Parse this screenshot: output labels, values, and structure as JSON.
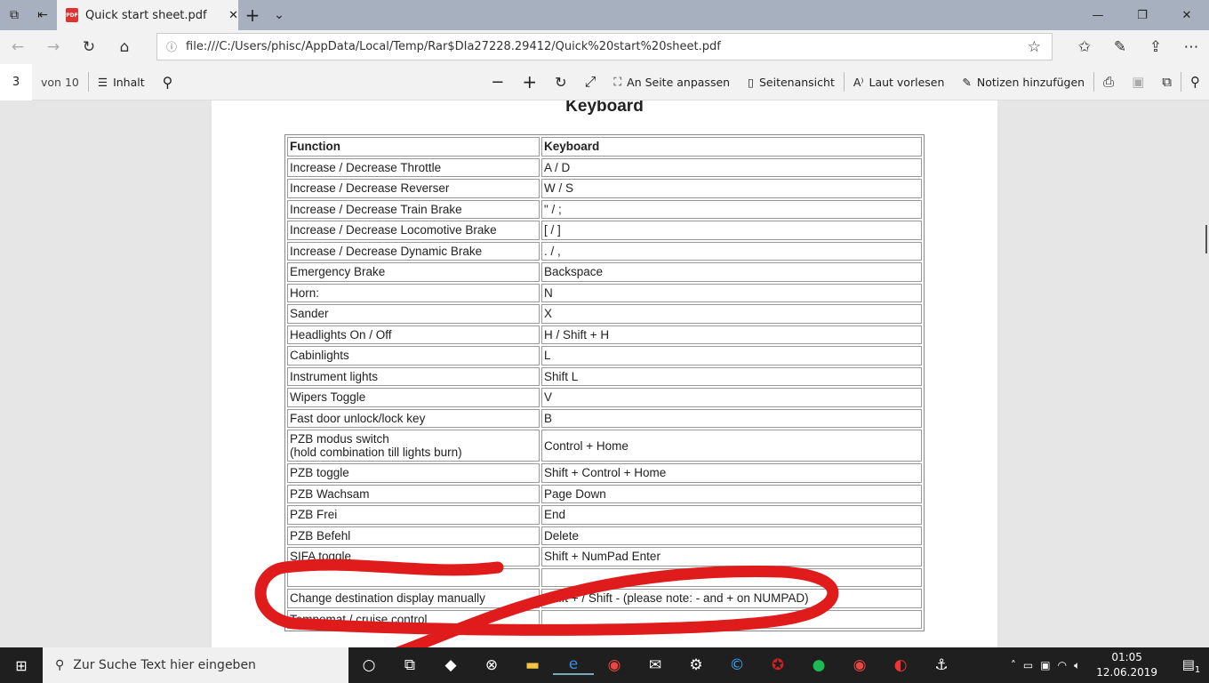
{
  "browser": {
    "tab_title": "Quick start sheet.pdf",
    "url": "file:///C:/Users/phisc/AppData/Local/Temp/Rar$DIa27228.29412/Quick%20start%20sheet.pdf"
  },
  "pdf_toolbar": {
    "page": "3",
    "of_pages": "von 10",
    "contents": "Inhalt",
    "fit_page": "An Seite anpassen",
    "page_view": "Seitenansicht",
    "read_aloud": "Laut vorlesen",
    "add_notes": "Notizen hinzufügen"
  },
  "document": {
    "title": "Keyboard",
    "headers": [
      "Function",
      "Keyboard"
    ],
    "rows": [
      [
        "Increase / Decrease Throttle",
        "A / D"
      ],
      [
        "Increase / Decrease Reverser",
        "W / S"
      ],
      [
        "Increase / Decrease Train Brake",
        "\" / ;"
      ],
      [
        "Increase / Decrease Locomotive Brake",
        "[ / ]"
      ],
      [
        "Increase / Decrease Dynamic Brake",
        ". / ,"
      ],
      [
        "Emergency Brake",
        "Backspace"
      ],
      [
        "Horn:",
        "N"
      ],
      [
        "Sander",
        "X"
      ],
      [
        "Headlights On / Off",
        "H / Shift + H"
      ],
      [
        "Cabinlights",
        "L"
      ],
      [
        "Instrument lights",
        "Shift L"
      ],
      [
        "Wipers Toggle",
        "V"
      ],
      [
        "Fast door unlock/lock key",
        "B"
      ],
      [
        "PZB modus switch\n(hold combination till lights burn)",
        "Control + Home"
      ],
      [
        "PZB toggle",
        "Shift + Control + Home"
      ],
      [
        "PZB Wachsam",
        "Page Down"
      ],
      [
        "PZB Frei",
        "End"
      ],
      [
        "PZB Befehl",
        "Delete"
      ],
      [
        "SIFA toggle",
        "Shift + NumPad Enter"
      ],
      [
        "",
        ""
      ],
      [
        "Change destination display manually",
        "Shift + / Shift - (please note: - and + on NUMPAD)"
      ],
      [
        "Tempomat / cruise control",
        ""
      ]
    ],
    "annotation_color": "#e01b1b"
  },
  "taskbar": {
    "search_placeholder": "Zur Suche Text hier eingeben",
    "time": "01:05",
    "date": "12.06.2019",
    "notifications": "1"
  }
}
